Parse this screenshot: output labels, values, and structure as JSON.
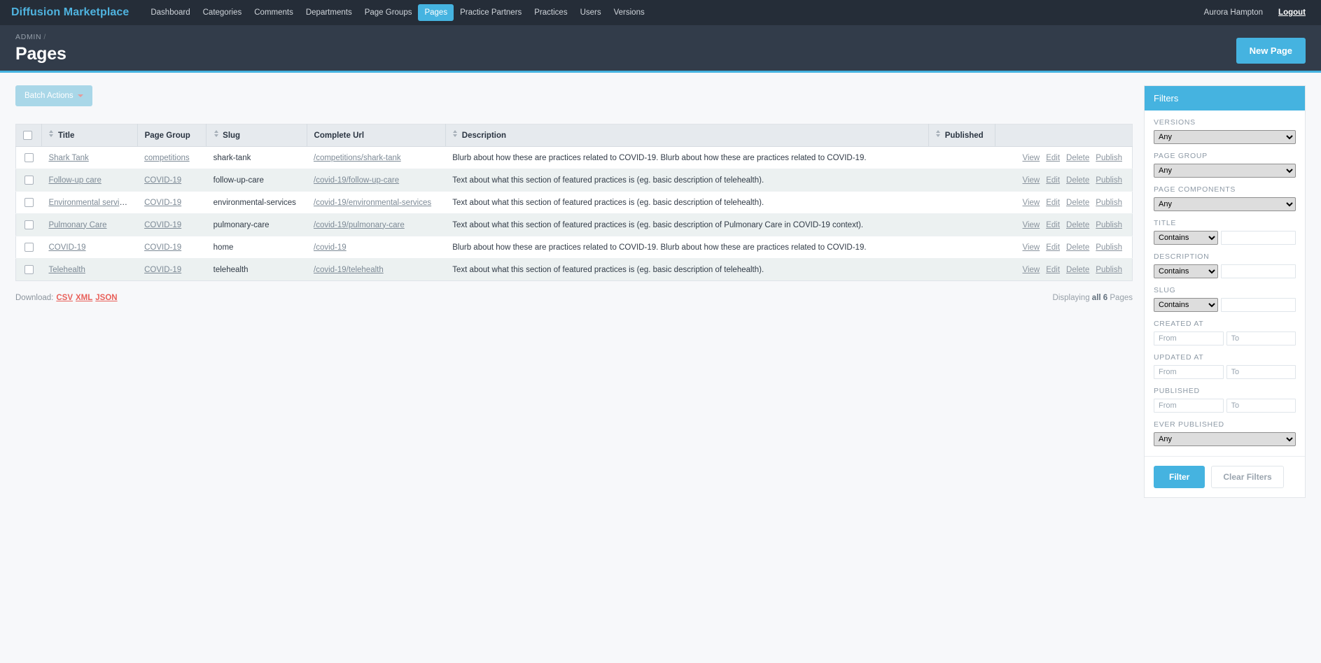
{
  "navbar": {
    "brand": "Diffusion Marketplace",
    "links": [
      {
        "label": "Dashboard",
        "active": false
      },
      {
        "label": "Categories",
        "active": false
      },
      {
        "label": "Comments",
        "active": false
      },
      {
        "label": "Departments",
        "active": false
      },
      {
        "label": "Page Groups",
        "active": false
      },
      {
        "label": "Pages",
        "active": true
      },
      {
        "label": "Practice Partners",
        "active": false
      },
      {
        "label": "Practices",
        "active": false
      },
      {
        "label": "Users",
        "active": false
      },
      {
        "label": "Versions",
        "active": false
      }
    ],
    "user": "Aurora Hampton",
    "logout": "Logout"
  },
  "header": {
    "breadcrumb": "ADMIN",
    "breadcrumb_sep": "/",
    "title": "Pages",
    "new_page_label": "New Page"
  },
  "toolbar": {
    "batch_actions_label": "Batch Actions"
  },
  "table": {
    "columns": [
      {
        "label": "Title",
        "sortable": true
      },
      {
        "label": "Page Group",
        "sortable": false
      },
      {
        "label": "Slug",
        "sortable": true
      },
      {
        "label": "Complete Url",
        "sortable": false
      },
      {
        "label": "Description",
        "sortable": true
      },
      {
        "label": "Published",
        "sortable": true
      }
    ],
    "row_actions": [
      "View",
      "Edit",
      "Delete",
      "Publish"
    ],
    "rows": [
      {
        "title": "Shark Tank",
        "page_group": "competitions",
        "slug": "shark-tank",
        "complete_url": "/competitions/shark-tank",
        "description": "Blurb about how these are practices related to COVID-19. Blurb about how these are practices related to COVID-19.",
        "published": ""
      },
      {
        "title": "Follow-up care",
        "page_group": "COVID-19",
        "slug": "follow-up-care",
        "complete_url": "/covid-19/follow-up-care",
        "description": "Text about what this section of featured practices is (eg. basic description of telehealth).",
        "published": ""
      },
      {
        "title": "Environmental services",
        "page_group": "COVID-19",
        "slug": "environmental-services",
        "complete_url": "/covid-19/environmental-services",
        "description": "Text about what this section of featured practices is (eg. basic description of telehealth).",
        "published": ""
      },
      {
        "title": "Pulmonary Care",
        "page_group": "COVID-19",
        "slug": "pulmonary-care",
        "complete_url": "/covid-19/pulmonary-care",
        "description": "Text about what this section of featured practices is (eg. basic description of Pulmonary Care in COVID-19 context).",
        "published": ""
      },
      {
        "title": "COVID-19",
        "page_group": "COVID-19",
        "slug": "home",
        "complete_url": "/covid-19",
        "description": "Blurb about how these are practices related to COVID-19. Blurb about how these are practices related to COVID-19.",
        "published": ""
      },
      {
        "title": "Telehealth",
        "page_group": "COVID-19",
        "slug": "telehealth",
        "complete_url": "/covid-19/telehealth",
        "description": "Text about what this section of featured practices is (eg. basic description of telehealth).",
        "published": ""
      }
    ]
  },
  "footer": {
    "download_label": "Download:",
    "download_links": [
      "CSV",
      "XML",
      "JSON"
    ],
    "pagination_prefix": "Displaying ",
    "pagination_strong": "all 6",
    "pagination_suffix": " Pages"
  },
  "filters": {
    "title": "Filters",
    "versions": {
      "label": "VERSIONS",
      "value": "Any",
      "options": [
        "Any"
      ]
    },
    "page_group": {
      "label": "PAGE GROUP",
      "value": "Any",
      "options": [
        "Any"
      ]
    },
    "page_components": {
      "label": "PAGE COMPONENTS",
      "value": "Any",
      "options": [
        "Any"
      ]
    },
    "title_filter": {
      "label": "TITLE",
      "op": "Contains",
      "ops": [
        "Contains"
      ],
      "value": "",
      "placeholder": ""
    },
    "description_filter": {
      "label": "DESCRIPTION",
      "op": "Contains",
      "ops": [
        "Contains"
      ],
      "value": "",
      "placeholder": ""
    },
    "slug_filter": {
      "label": "SLUG",
      "op": "Contains",
      "ops": [
        "Contains"
      ],
      "value": "",
      "placeholder": ""
    },
    "created_at": {
      "label": "CREATED AT",
      "from_placeholder": "From",
      "to_placeholder": "To",
      "from": "",
      "to": ""
    },
    "updated_at": {
      "label": "UPDATED AT",
      "from_placeholder": "From",
      "to_placeholder": "To",
      "from": "",
      "to": ""
    },
    "published": {
      "label": "PUBLISHED",
      "from_placeholder": "From",
      "to_placeholder": "To",
      "from": "",
      "to": ""
    },
    "ever_published": {
      "label": "EVER PUBLISHED",
      "value": "Any",
      "options": [
        "Any"
      ]
    },
    "filter_button": "Filter",
    "clear_button": "Clear Filters"
  },
  "colors": {
    "accent": "#45b3e0",
    "navbar_bg": "#252d38",
    "header_bg": "#323c4a",
    "download_link": "#e8605a"
  }
}
